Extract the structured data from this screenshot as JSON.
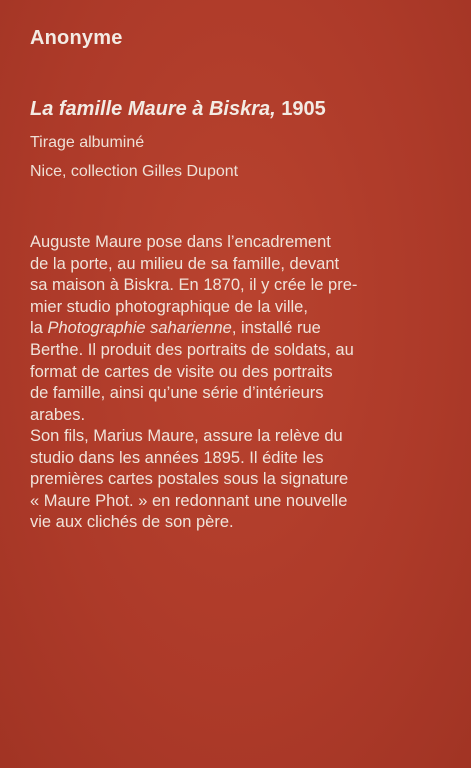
{
  "label": {
    "author": "Anonyme",
    "title_italic": "La famille Maure à Biskra,",
    "title_year": "1905",
    "technique": "Tirage albuminé",
    "collection": "Nice, collection Gilles Dupont",
    "paragraph1": [
      {
        "text": "Auguste Maure pose dans l’encadrement"
      },
      {
        "text": "de la porte, au milieu de sa famille, devant"
      },
      {
        "text": "sa maison à Biskra. En 1870, il y crée le pre-"
      },
      {
        "text": "mier studio photographique de la ville,"
      },
      {
        "pre": "la ",
        "italic": "Photographie saharienne",
        "post": ", installé rue"
      },
      {
        "text": "Berthe. Il produit des portraits de soldats, au"
      },
      {
        "text": "format de cartes de visite ou des portraits"
      },
      {
        "text": "de famille, ainsi qu’une série d’intérieurs"
      },
      {
        "text": "arabes."
      }
    ],
    "paragraph2": [
      {
        "text": "Son fils, Marius Maure, assure la relève du"
      },
      {
        "text": "studio dans les années 1895. Il édite les"
      },
      {
        "text": "premières cartes postales sous la signature"
      },
      {
        "text": "« Maure Phot. » en redonnant une nouvelle"
      },
      {
        "text": "vie aux clichés de son père."
      }
    ]
  },
  "colors": {
    "background": "#b13d2c",
    "text": "#f1e7df"
  }
}
